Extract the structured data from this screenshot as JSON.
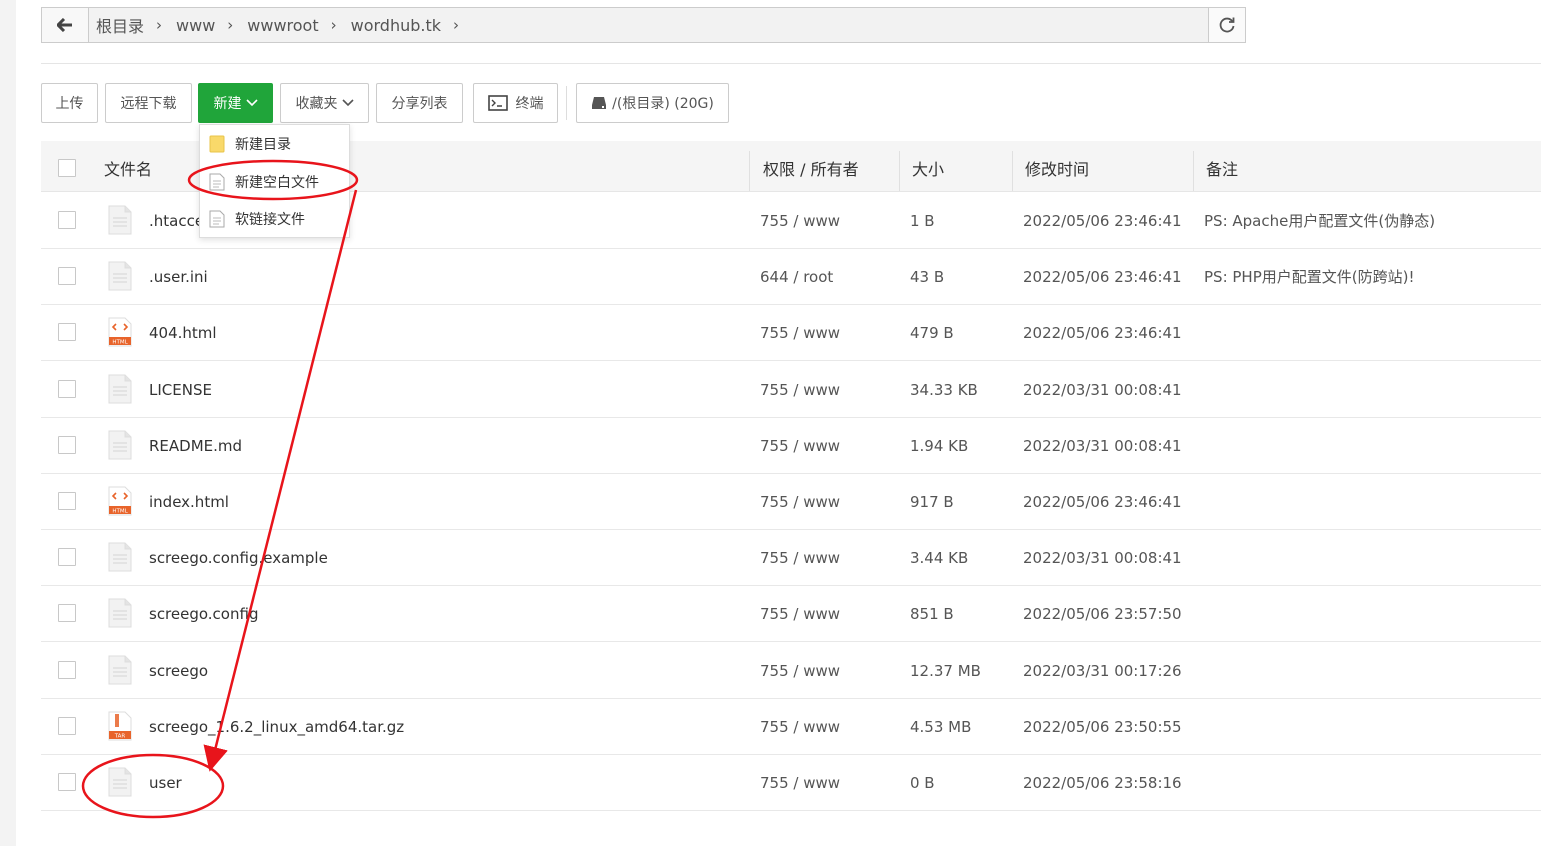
{
  "breadcrumb": {
    "items": [
      "根目录",
      "www",
      "wwwroot",
      "wordhub.tk"
    ],
    "back_icon": "arrow-left-icon",
    "refresh_icon": "refresh-icon"
  },
  "toolbar": {
    "upload": "上传",
    "remote_download": "远程下载",
    "new": "新建",
    "favorites": "收藏夹",
    "share_list": "分享列表",
    "terminal": "终端",
    "disk": "/(根目录) (20G)"
  },
  "new_menu": {
    "items": [
      "新建目录",
      "新建空白文件",
      "软链接文件"
    ]
  },
  "table": {
    "headers": {
      "name": "文件名",
      "perm": "权限 / 所有者",
      "size": "大小",
      "mtime": "修改时间",
      "note": "备注"
    },
    "rows": [
      {
        "name": ".htaccess",
        "type": "file",
        "perm": "755 / www",
        "size": "1 B",
        "mtime": "2022/05/06 23:46:41",
        "note": "PS: Apache用户配置文件(伪静态)"
      },
      {
        "name": ".user.ini",
        "type": "file",
        "perm": "644 / root",
        "size": "43 B",
        "mtime": "2022/05/06 23:46:41",
        "note": "PS: PHP用户配置文件(防跨站)!"
      },
      {
        "name": "404.html",
        "type": "html",
        "perm": "755 / www",
        "size": "479 B",
        "mtime": "2022/05/06 23:46:41",
        "note": ""
      },
      {
        "name": "LICENSE",
        "type": "file",
        "perm": "755 / www",
        "size": "34.33 KB",
        "mtime": "2022/03/31 00:08:41",
        "note": ""
      },
      {
        "name": "README.md",
        "type": "file",
        "perm": "755 / www",
        "size": "1.94 KB",
        "mtime": "2022/03/31 00:08:41",
        "note": ""
      },
      {
        "name": "index.html",
        "type": "html",
        "perm": "755 / www",
        "size": "917 B",
        "mtime": "2022/05/06 23:46:41",
        "note": ""
      },
      {
        "name": "screego.config.example",
        "type": "file",
        "perm": "755 / www",
        "size": "3.44 KB",
        "mtime": "2022/03/31 00:08:41",
        "note": ""
      },
      {
        "name": "screego.config",
        "type": "file",
        "perm": "755 / www",
        "size": "851 B",
        "mtime": "2022/05/06 23:57:50",
        "note": ""
      },
      {
        "name": "screego",
        "type": "file",
        "perm": "755 / www",
        "size": "12.37 MB",
        "mtime": "2022/03/31 00:17:26",
        "note": ""
      },
      {
        "name": "screego_1.6.2_linux_amd64.tar.gz",
        "type": "tar",
        "perm": "755 / www",
        "size": "4.53 MB",
        "mtime": "2022/05/06 23:50:55",
        "note": ""
      },
      {
        "name": "user",
        "type": "file",
        "perm": "755 / www",
        "size": "0 B",
        "mtime": "2022/05/06 23:58:16",
        "note": ""
      }
    ]
  },
  "icon_labels": {
    "html": "HTML",
    "tar": "TAR"
  },
  "colors": {
    "accent": "#20a53a",
    "annotation": "#e8141b",
    "html_icon": "#e8642b"
  }
}
